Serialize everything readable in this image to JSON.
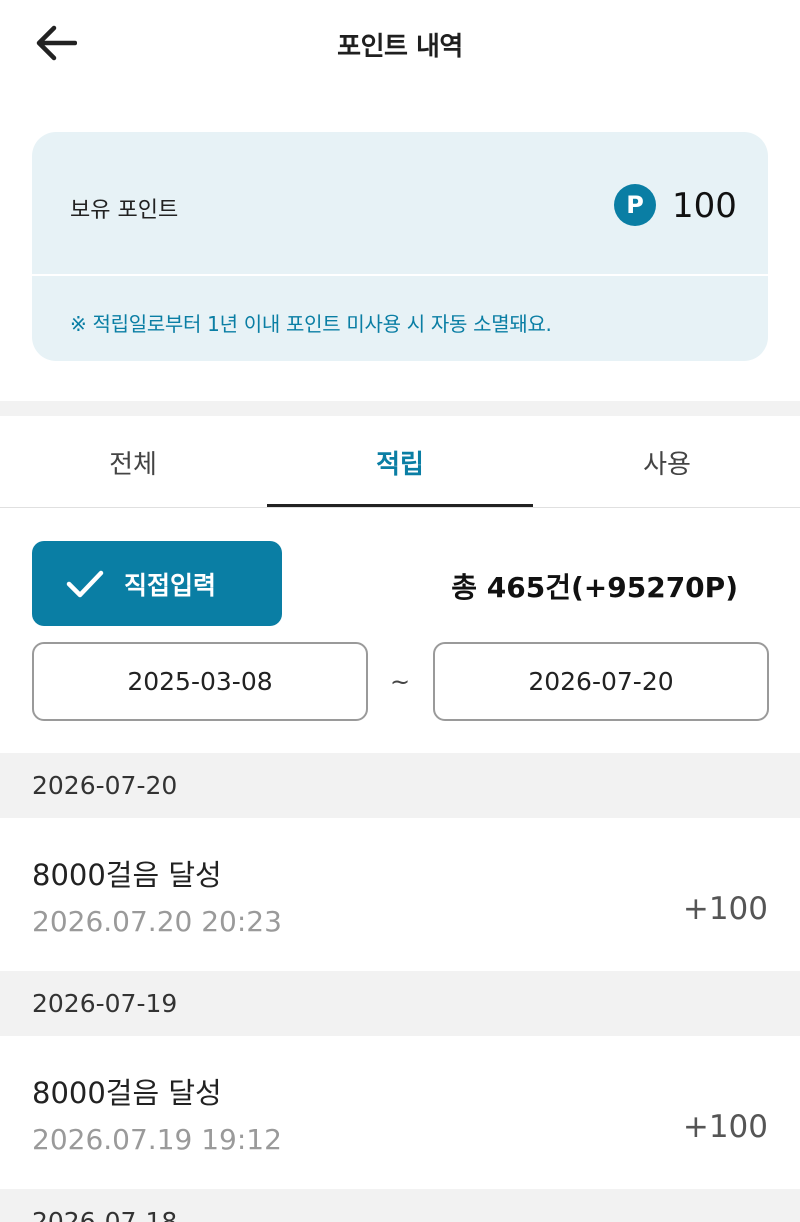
{
  "header": {
    "title": "포인트 내역",
    "back_icon": "arrow-left-icon"
  },
  "point_card": {
    "label": "보유 포인트",
    "badge": "P",
    "value": "100",
    "notice": "※ 적립일로부터 1년 이내 포인트 미사용 시 자동 소멸돼요.",
    "background_color": "#e7f2f6",
    "accent_color": "#0a7ea4"
  },
  "tabs": [
    {
      "label": "전체",
      "active": false
    },
    {
      "label": "적립",
      "active": true
    },
    {
      "label": "사용",
      "active": false
    }
  ],
  "filter": {
    "direct_input_label": "직접입력",
    "check_icon": "check-icon",
    "total_text": "총 465건(+95270P)",
    "start_date": "2025-03-08",
    "separator": "~",
    "end_date": "2026-07-20"
  },
  "groups": [
    {
      "date": "2026-07-20",
      "items": [
        {
          "title": "8000걸음 달성",
          "time": "2026.07.20 20:23",
          "amount": "+100"
        }
      ]
    },
    {
      "date": "2026-07-19",
      "items": [
        {
          "title": "8000걸음 달성",
          "time": "2026.07.19 19:12",
          "amount": "+100"
        }
      ]
    },
    {
      "date": "2026-07-18",
      "items": []
    }
  ]
}
